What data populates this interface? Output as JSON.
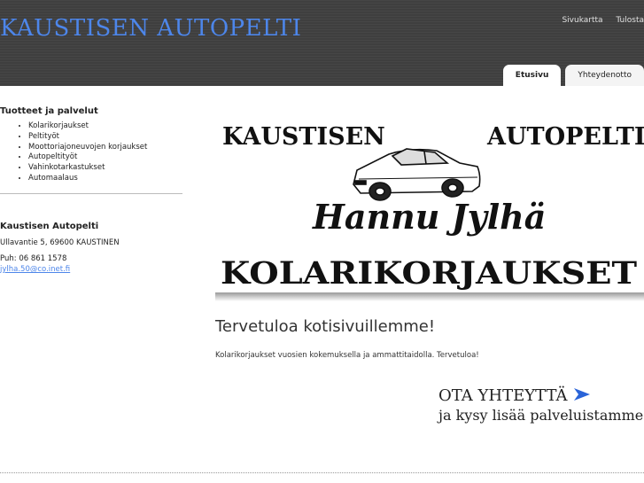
{
  "header": {
    "title": "KAUSTISEN AUTOPELTI",
    "top_links": [
      "Sivukartta",
      "Tulosta"
    ],
    "tabs": [
      {
        "label": "Etusivu",
        "active": true
      },
      {
        "label": "Yhteydenotto",
        "active": false
      }
    ]
  },
  "sidebar": {
    "products_heading": "Tuotteet ja palvelut",
    "items": [
      "Kolarikorjaukset",
      "Peltityöt",
      "Moottoriajoneuvojen korjaukset",
      "Autopeltityöt",
      "Vahinkotarkastukset",
      "Automaalaus"
    ],
    "company_heading": "Kaustisen Autopelti",
    "address": "Ullavantie 5, 69600 KAUSTINEN",
    "phone": "Puh: 06 861 1578",
    "email": "jylha.50@co.inet.fi"
  },
  "main": {
    "logo": {
      "left_word": "KAUSTISEN",
      "right_word": "AUTOPELTI",
      "name": "Hannu Jylhä",
      "service": "KOLARIKORJAUKSET"
    },
    "welcome": "Tervetuloa kotisivuillemme!",
    "intro": "Kolarikorjaukset vuosien kokemuksella ja ammattitaidolla. Tervetuloa!",
    "cta_title": "OTA YHTEYTTÄ",
    "cta_sub": "ja kysy lisää palveluistamme"
  },
  "colors": {
    "header_bg": "#3f3f3f",
    "brand_blue": "#4d86ea",
    "arrow_blue": "#2a64d8"
  },
  "icons": {
    "car": "car-illustration",
    "arrow": "arrow-right-icon"
  }
}
